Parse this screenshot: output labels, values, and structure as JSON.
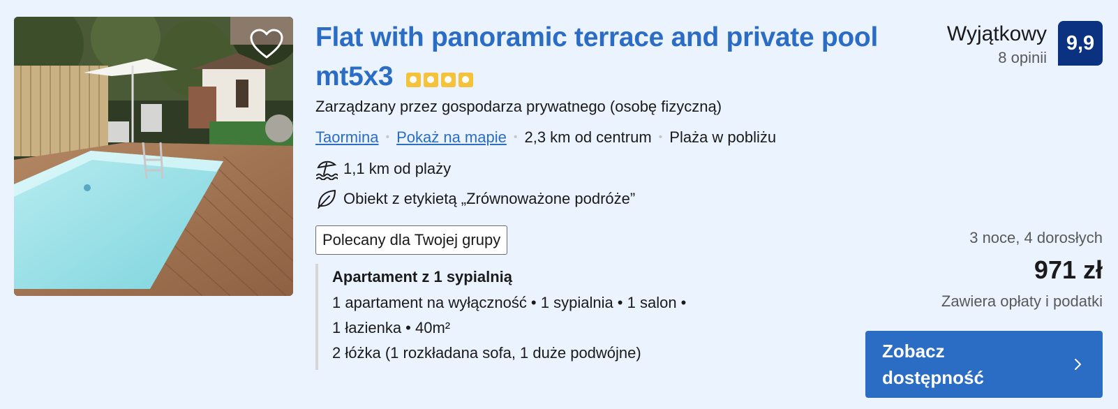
{
  "listing": {
    "title": "Flat with panoramic terrace and private pool mt5x3",
    "stars": 4,
    "managed_by": "Zarządzany przez gospodarza prywatnego (osobę fizyczną)",
    "location": {
      "city": "Taormina",
      "map_link": "Pokaż na mapie",
      "distance": "2,3 km od centrum",
      "beach": "Plaża w pobliżu"
    },
    "features": [
      {
        "icon": "beach-umbrella-icon",
        "text": "1,1 km od plaży"
      },
      {
        "icon": "leaf-icon",
        "text": "Obiekt z etykietą „Zrównoważone podróże”"
      }
    ],
    "badge": "Polecany dla Twojej grupy",
    "unit": {
      "name": "Apartament z 1 sypialnią",
      "lines": [
        "1 apartament na wyłączność • 1 sypialnia • 1 salon •",
        "1 łazienka • 40m²",
        "2 łóżka (1 rozkładana sofa, 1 duże podwójne)"
      ]
    }
  },
  "rating": {
    "word": "Wyjątkowy",
    "reviews": "8 opinii",
    "score": "9,9"
  },
  "pricing": {
    "stay": "3 noce, 4 dorosłych",
    "price": "971 zł",
    "fees": "Zawiera opłaty i podatki",
    "cta": "Zobacz dostępność"
  },
  "colors": {
    "background": "#ebf3ff",
    "link": "#2b6cc4",
    "score_bg": "#0b3280",
    "star": "#f5c33b",
    "cta": "#2b6cc4"
  }
}
